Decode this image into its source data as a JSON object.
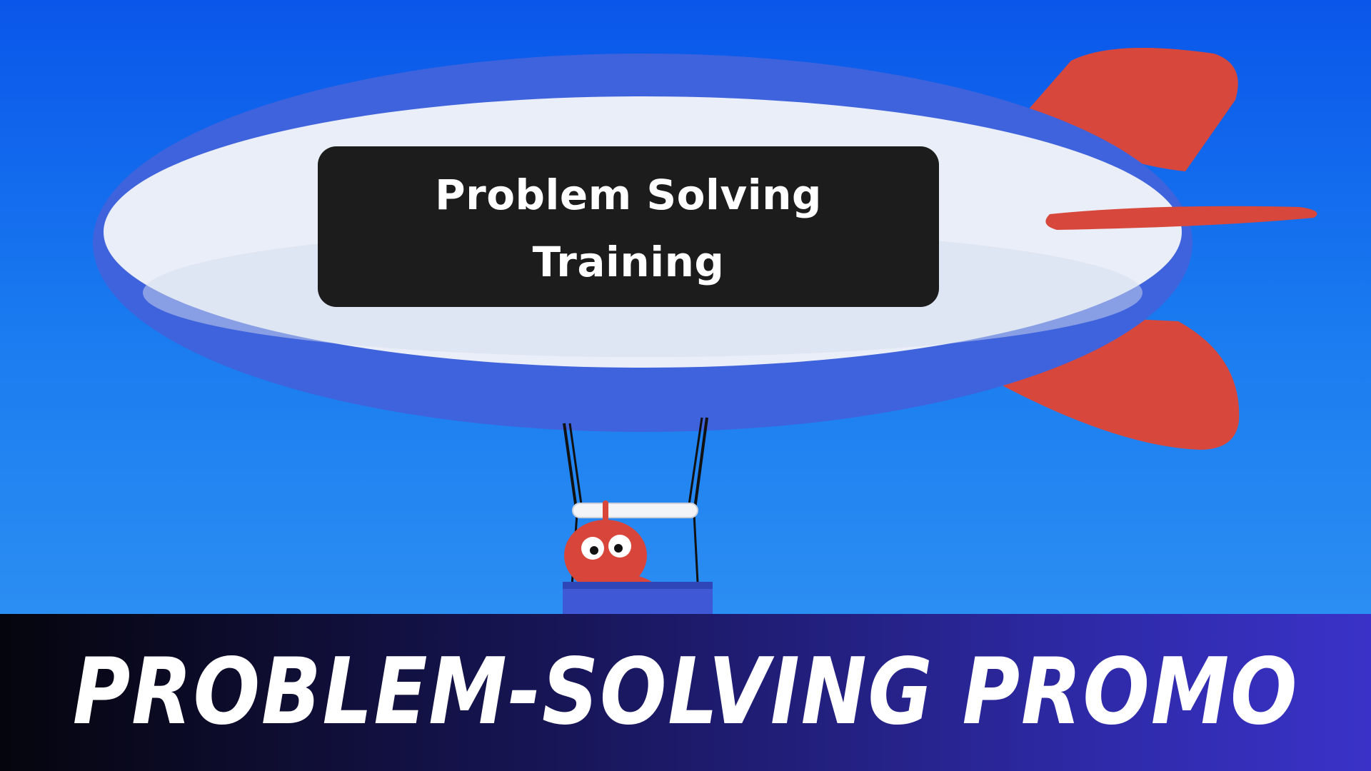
{
  "blimp": {
    "sign_line1": "Problem Solving",
    "sign_line2": "Training"
  },
  "caption": {
    "title": "PROBLEM-SOLVING PROMO"
  },
  "colors": {
    "sky_top": "#0a56ea",
    "sky_bottom": "#2b8ef2",
    "blimp_blue": "#3f63dc",
    "blimp_white": "#e9eef8",
    "fin_red": "#d8473c",
    "sign_black": "#1c1c1c",
    "character_red": "#d8453a"
  }
}
